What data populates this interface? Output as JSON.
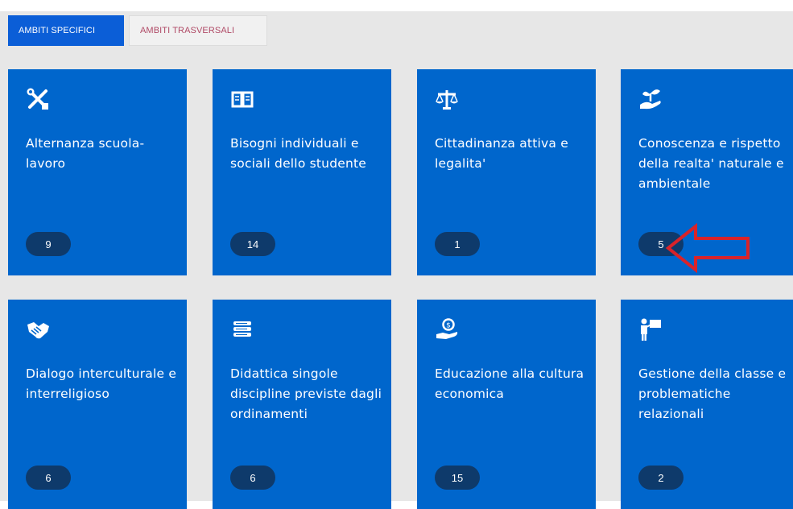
{
  "tabs": [
    {
      "label": "AMBITI SPECIFICI",
      "active": true
    },
    {
      "label": "AMBITI TRASVERSALI",
      "active": false
    }
  ],
  "cards": [
    {
      "title": "Alternanza scuola-lavoro",
      "count": "9",
      "icon": "tools-icon"
    },
    {
      "title": "Bisogni individuali e sociali dello studente",
      "count": "14",
      "icon": "open-book-icon"
    },
    {
      "title": "Cittadinanza attiva e legalita'",
      "count": "1",
      "icon": "balance-scale-icon"
    },
    {
      "title": "Conoscenza e rispetto della realta' naturale e ambientale",
      "count": "5",
      "icon": "seedling-hand-icon"
    },
    {
      "title": "Dialogo interculturale e interreligioso",
      "count": "6",
      "icon": "handshake-icon"
    },
    {
      "title": "Didattica singole discipline previste dagli ordinamenti",
      "count": "6",
      "icon": "stacked-books-icon"
    },
    {
      "title": "Educazione alla cultura economica",
      "count": "15",
      "icon": "coin-hand-icon"
    },
    {
      "title": "Gestione della classe e problematiche relazionali",
      "count": "2",
      "icon": "teacher-board-icon"
    }
  ],
  "colors": {
    "card": "#0066cc",
    "badge": "#0e3a6b",
    "tab_active": "#0b5ed7",
    "annotation_arrow": "#d9232a"
  },
  "annotation": {
    "shape": "left-pointing-arrow",
    "target": "card-4-count"
  }
}
